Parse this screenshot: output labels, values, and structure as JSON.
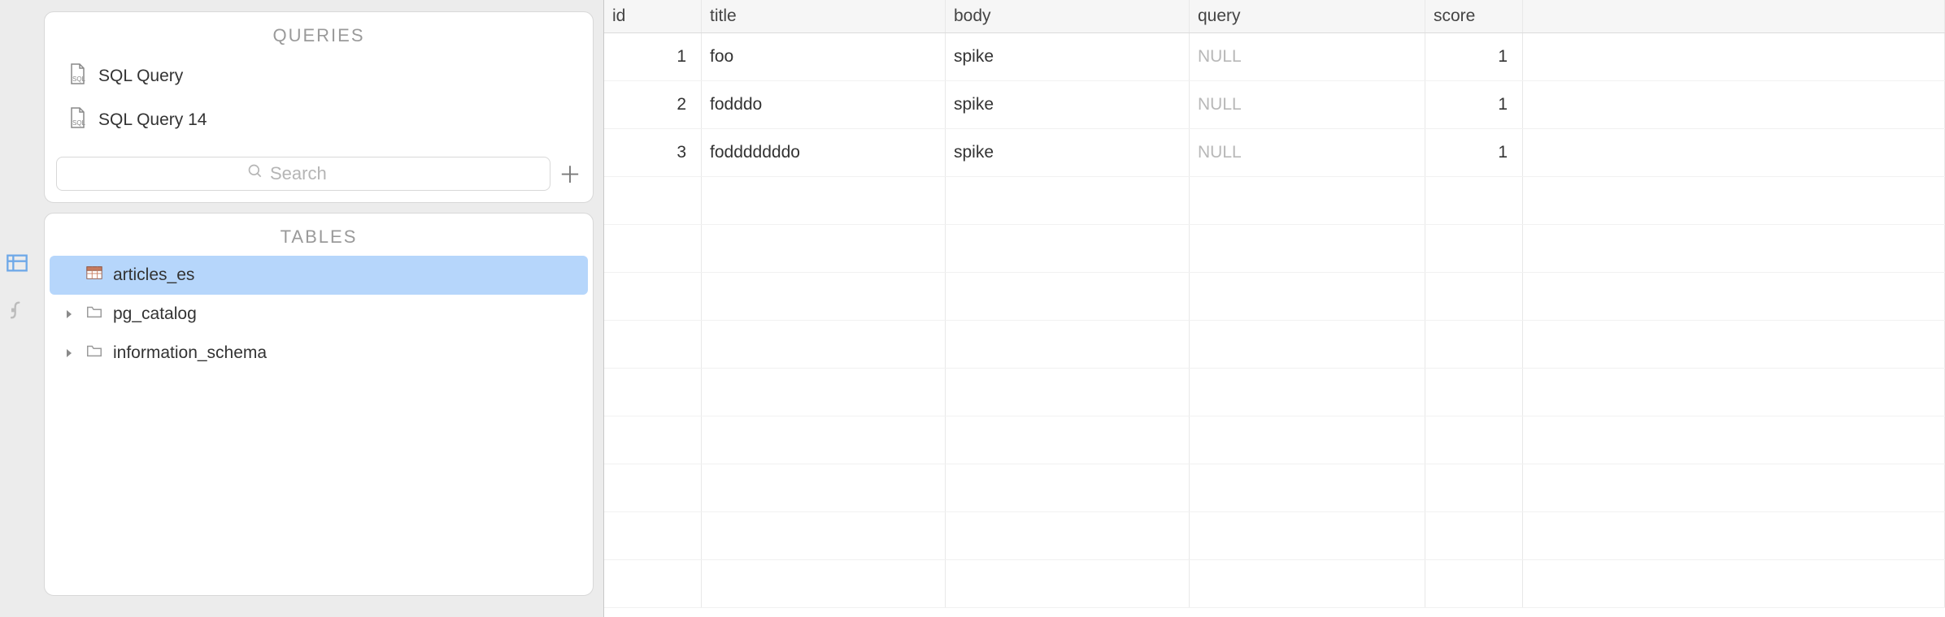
{
  "sidebar": {
    "queries": {
      "header": "QUERIES",
      "items": [
        {
          "label": "SQL Query"
        },
        {
          "label": "SQL Query 14"
        }
      ],
      "search_placeholder": "Search"
    },
    "tables": {
      "header": "TABLES",
      "items": [
        {
          "label": "articles_es",
          "type": "table",
          "selected": true
        },
        {
          "label": "pg_catalog",
          "type": "folder",
          "expandable": true
        },
        {
          "label": "information_schema",
          "type": "folder",
          "expandable": true
        }
      ]
    }
  },
  "grid": {
    "columns": [
      "id",
      "title",
      "body",
      "query",
      "score"
    ],
    "rows": [
      {
        "id": "1",
        "title": "foo",
        "body": "spike",
        "query": null,
        "score": "1"
      },
      {
        "id": "2",
        "title": "fodddo",
        "body": "spike",
        "query": null,
        "score": "1"
      },
      {
        "id": "3",
        "title": "fodddddddo",
        "body": "spike",
        "query": null,
        "score": "1"
      }
    ],
    "null_label": "NULL",
    "empty_rows": 9
  }
}
